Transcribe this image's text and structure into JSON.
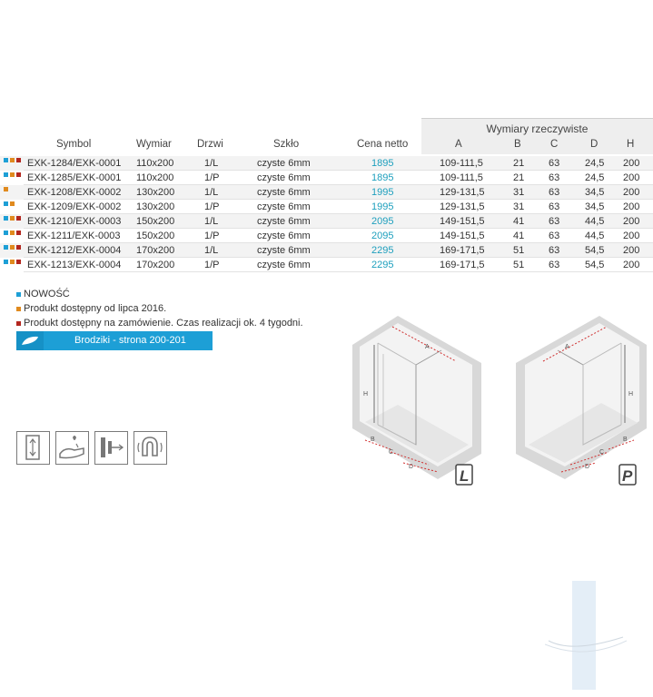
{
  "table": {
    "group_header": "Wymiary rzeczywiste",
    "headers": {
      "symbol": "Symbol",
      "wymiar": "Wymiar",
      "drzwi": "Drzwi",
      "szklo": "Szkło",
      "cena": "Cena netto",
      "a": "A",
      "b": "B",
      "c": "C",
      "d": "D",
      "h": "H"
    },
    "rows": [
      {
        "symbol": "EXK-1284/EXK-0001",
        "wymiar": "110x200",
        "drzwi": "1/L",
        "szklo": "czyste 6mm",
        "cena": "1895",
        "a": "109-111,5",
        "b": "21",
        "c": "63",
        "d": "24,5",
        "h": "200"
      },
      {
        "symbol": "EXK-1285/EXK-0001",
        "wymiar": "110x200",
        "drzwi": "1/P",
        "szklo": "czyste 6mm",
        "cena": "1895",
        "a": "109-111,5",
        "b": "21",
        "c": "63",
        "d": "24,5",
        "h": "200"
      },
      {
        "symbol": "EXK-1208/EXK-0002",
        "wymiar": "130x200",
        "drzwi": "1/L",
        "szklo": "czyste 6mm",
        "cena": "1995",
        "a": "129-131,5",
        "b": "31",
        "c": "63",
        "d": "34,5",
        "h": "200"
      },
      {
        "symbol": "EXK-1209/EXK-0002",
        "wymiar": "130x200",
        "drzwi": "1/P",
        "szklo": "czyste 6mm",
        "cena": "1995",
        "a": "129-131,5",
        "b": "31",
        "c": "63",
        "d": "34,5",
        "h": "200"
      },
      {
        "symbol": "EXK-1210/EXK-0003",
        "wymiar": "150x200",
        "drzwi": "1/L",
        "szklo": "czyste 6mm",
        "cena": "2095",
        "a": "149-151,5",
        "b": "41",
        "c": "63",
        "d": "44,5",
        "h": "200"
      },
      {
        "symbol": "EXK-1211/EXK-0003",
        "wymiar": "150x200",
        "drzwi": "1/P",
        "szklo": "czyste 6mm",
        "cena": "2095",
        "a": "149-151,5",
        "b": "41",
        "c": "63",
        "d": "44,5",
        "h": "200"
      },
      {
        "symbol": "EXK-1212/EXK-0004",
        "wymiar": "170x200",
        "drzwi": "1/L",
        "szklo": "czyste 6mm",
        "cena": "2295",
        "a": "169-171,5",
        "b": "51",
        "c": "63",
        "d": "54,5",
        "h": "200"
      },
      {
        "symbol": "EXK-1213/EXK-0004",
        "wymiar": "170x200",
        "drzwi": "1/P",
        "szklo": "czyste 6mm",
        "cena": "2295",
        "a": "169-171,5",
        "b": "51",
        "c": "63",
        "d": "54,5",
        "h": "200"
      }
    ]
  },
  "notes": [
    {
      "text": "NOWOŚĆ",
      "color": "#1d9fd6"
    },
    {
      "text": "Produkt dostępny od lipca 2016.",
      "color": "#e08a1e"
    },
    {
      "text": "Produkt dostępny na zamówienie. Czas realizacji ok. 4 tygodni.",
      "color": "#b3261e"
    }
  ],
  "banner": {
    "label": "Brodziki - strona 200-201"
  },
  "drawings": {
    "left": {
      "badge": "L",
      "labels": {
        "a": "A",
        "h": "H",
        "b": "B",
        "c": "C",
        "d": "D"
      }
    },
    "right": {
      "badge": "P",
      "labels": {
        "a": "A",
        "h": "H",
        "b": "B",
        "c": "C",
        "d": "D"
      }
    }
  },
  "icons": [
    "door-height-icon",
    "hand-wash-icon",
    "wall-profile-icon",
    "magnet-icon"
  ],
  "colors": {
    "accent": "#1d9fd6",
    "price": "#1d9fbd",
    "sq_blue": "#1d9fd6",
    "sq_orange": "#e08a1e",
    "sq_red": "#b3261e"
  }
}
